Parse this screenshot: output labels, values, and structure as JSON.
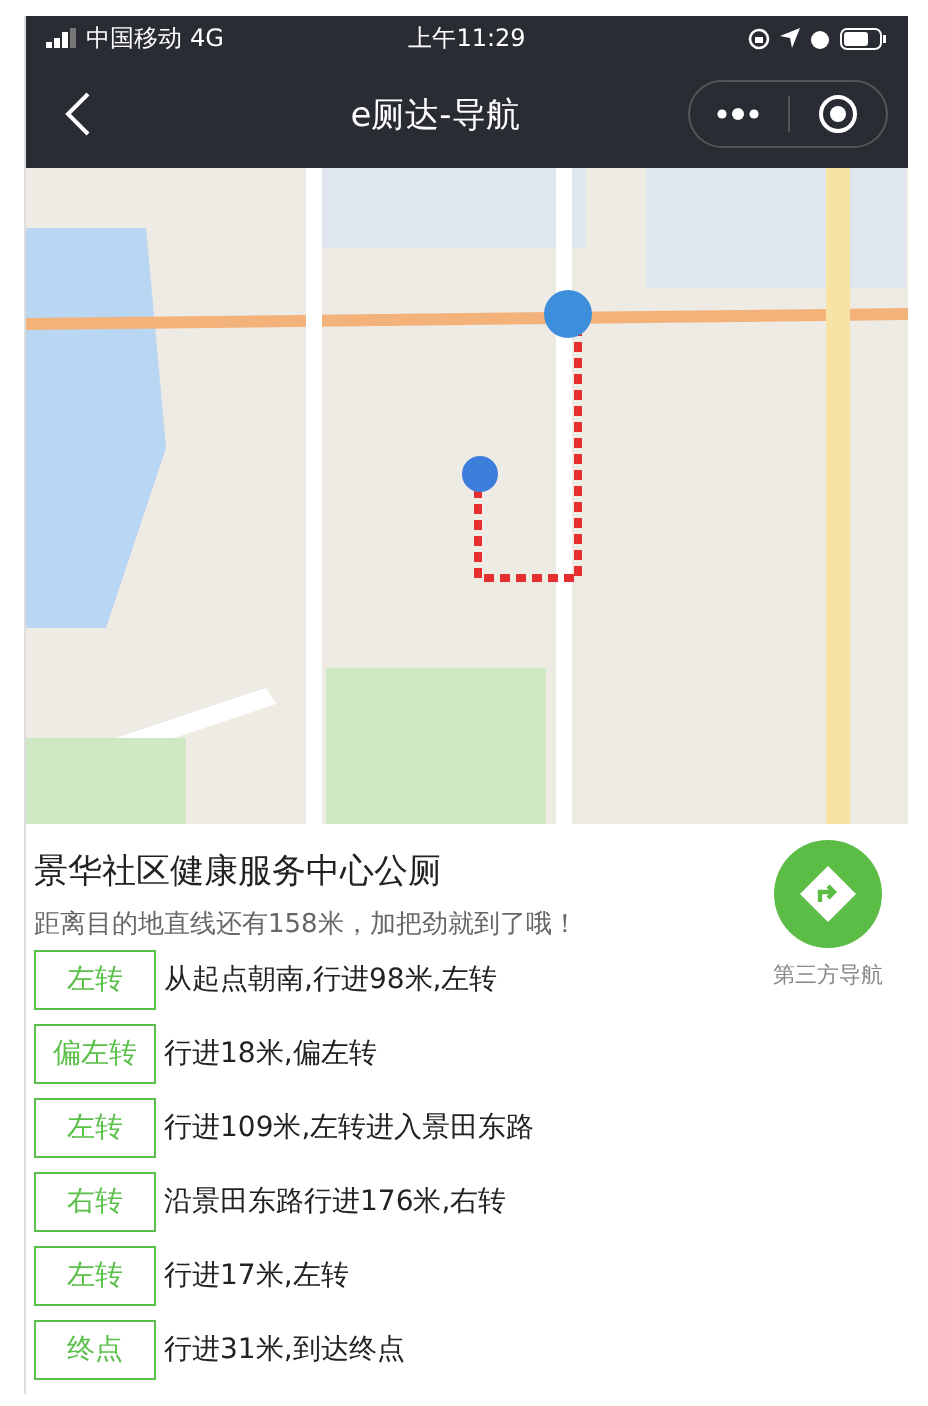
{
  "status_bar": {
    "carrier": "中国移动",
    "network": "4G",
    "time": "上午11:29"
  },
  "nav_bar": {
    "title": "e厕达-导航"
  },
  "destination": {
    "name": "景华社区健康服务中心公厕",
    "distance_note": "距离目的地直线还有158米，加把劲就到了哦！",
    "third_party_label": "第三方导航"
  },
  "steps": [
    {
      "action": "左转",
      "text": "从起点朝南,行进98米,左转"
    },
    {
      "action": "偏左转",
      "text": "行进18米,偏左转"
    },
    {
      "action": "左转",
      "text": "行进109米,左转进入景田东路"
    },
    {
      "action": "右转",
      "text": "沿景田东路行进176米,右转"
    },
    {
      "action": "左转",
      "text": "行进17米,左转"
    },
    {
      "action": "终点",
      "text": "行进31米,到达终点"
    }
  ]
}
